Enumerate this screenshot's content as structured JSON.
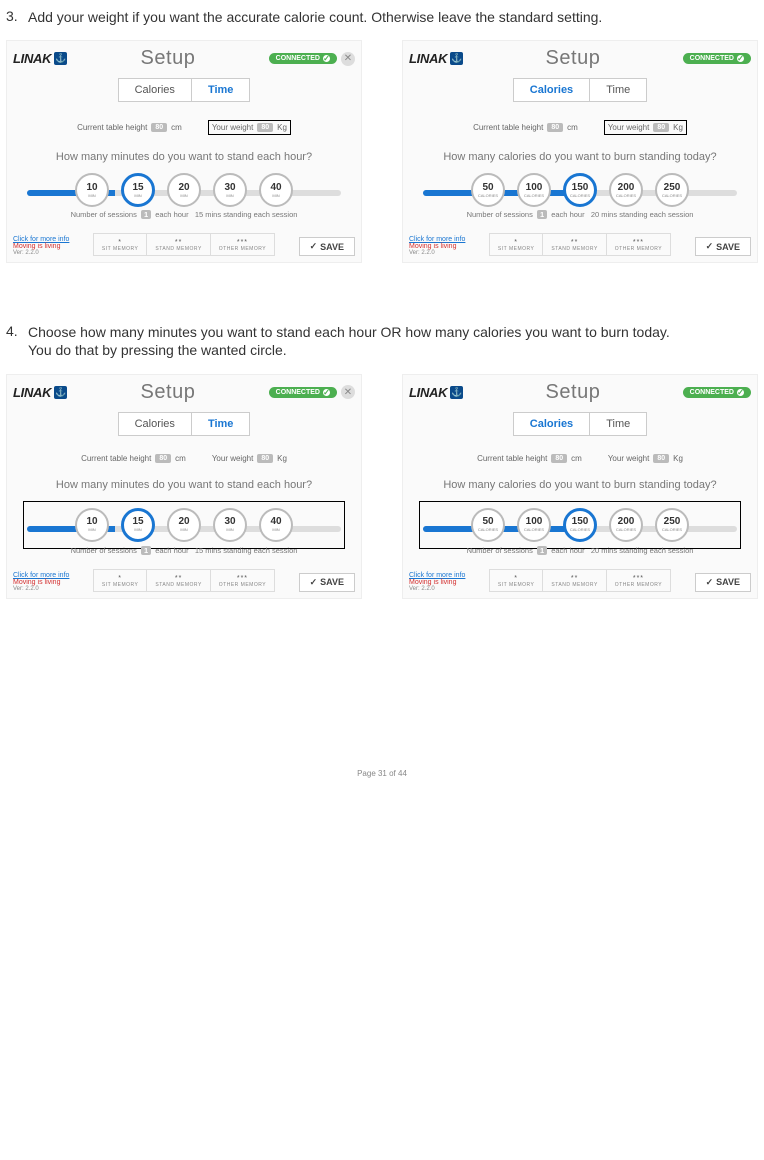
{
  "steps": {
    "s3": {
      "num": "3.",
      "text": "Add your weight if you want the accurate calorie count. Otherwise leave the standard setting."
    },
    "s4": {
      "num": "4.",
      "text": "Choose how many minutes you want to stand each hour OR how many calories you want to burn today.",
      "sub": "You do that by pressing the wanted circle."
    }
  },
  "common": {
    "brand": "LINAK",
    "title": "Setup",
    "connected": "CONNECTED",
    "tab_cal": "Calories",
    "tab_time": "Time",
    "f_height": "Current table height",
    "f_height_val": "80",
    "f_height_unit": "cm",
    "f_weight": "Your weight",
    "f_weight_val": "80",
    "f_weight_unit": "Kg",
    "q_time": "How many minutes do you want to stand each hour?",
    "q_cal": "How many calories do you want to burn standing today?",
    "sess_pre": "Number of sessions",
    "sess_val": "1",
    "sess_mid": "each hour",
    "sess_time": "15 mins standing each session",
    "sess_cal": "20 mins standing each session",
    "mem1": "SIT MEMORY",
    "mem2": "STAND MEMORY",
    "mem3": "OTHER MEMORY",
    "link_info": "Click for more info",
    "link_moving": "Moving is living",
    "ver": "Ver: 2.2.0",
    "save": "SAVE"
  },
  "opts_time": [
    {
      "v": "10",
      "u": "MIN"
    },
    {
      "v": "15",
      "u": "MIN"
    },
    {
      "v": "20",
      "u": "MIN"
    },
    {
      "v": "30",
      "u": "MIN"
    },
    {
      "v": "40",
      "u": "MIN"
    }
  ],
  "opts_cal": [
    {
      "v": "50",
      "u": "CALORIES"
    },
    {
      "v": "100",
      "u": "CALORIES"
    },
    {
      "v": "150",
      "u": "CALORIES"
    },
    {
      "v": "200",
      "u": "CALORIES"
    },
    {
      "v": "250",
      "u": "CALORIES"
    }
  ],
  "barfill_time": "28%",
  "barfill_cal": "48%",
  "page": "Page 31 of 44"
}
